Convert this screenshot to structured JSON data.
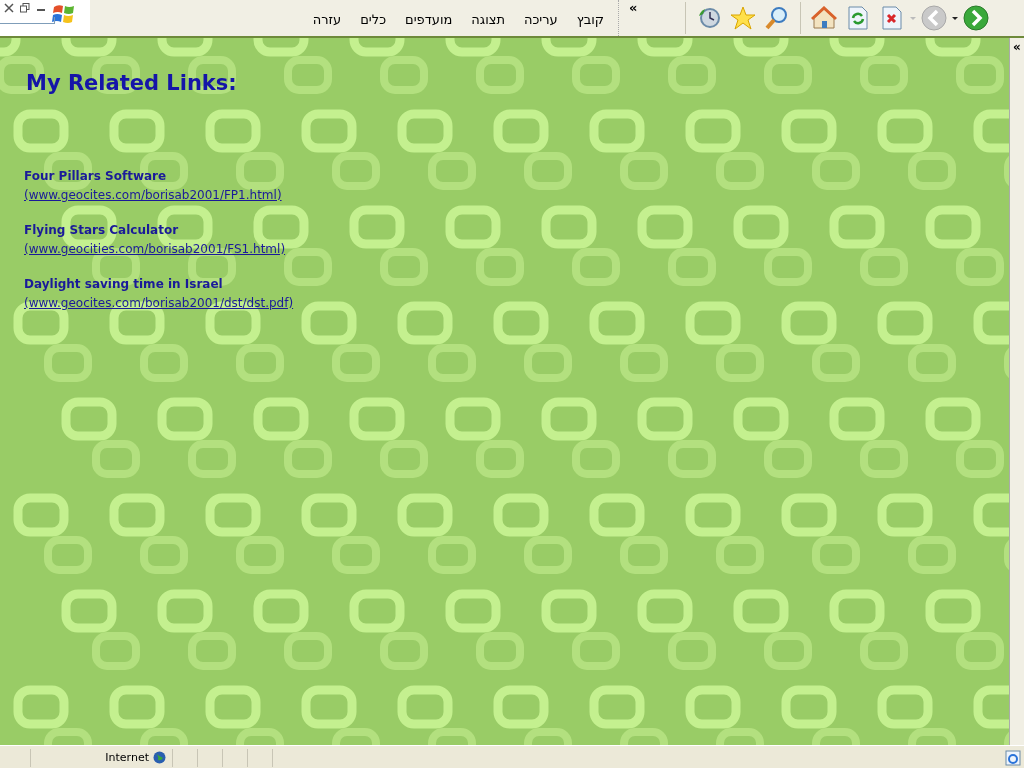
{
  "menu_bar": {
    "items": [
      "קובץ",
      "עריכה",
      "תצוגה",
      "מועדפים",
      "כלים",
      "עזרה"
    ],
    "overflow": "«"
  },
  "page": {
    "heading": "My Related Links:",
    "links": [
      {
        "title": "Four Pillars Software",
        "url": "(www.geocites.com/borisab2001/FP1.html)"
      },
      {
        "title": "Flying Stars Calculator",
        "url": "(www.geocities.com/borisab2001/FS1.html)"
      },
      {
        "title": "Daylight saving time in Israel",
        "url": "(www.geocites.com/borisab2001/dst/dst.pdf)"
      }
    ]
  },
  "side_panel": {
    "toggle": "«"
  },
  "status_bar": {
    "zone": "Internet"
  }
}
